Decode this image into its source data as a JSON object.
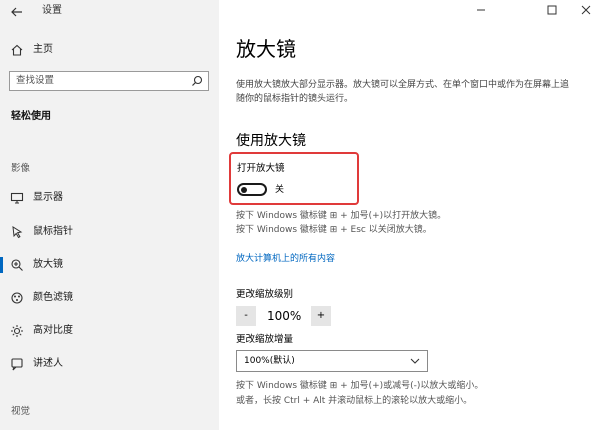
{
  "window": {
    "title": "设置"
  },
  "sidebar": {
    "home_label": "主页",
    "search_placeholder": "查找设置",
    "section_title": "轻松使用",
    "category_vision": "影像",
    "category_hearing": "视觉",
    "items": [
      {
        "label": "显示器",
        "icon": "monitor-icon"
      },
      {
        "label": "鼠标指针",
        "icon": "mouse-pointer-icon"
      },
      {
        "label": "放大镜",
        "icon": "magnifier-icon",
        "active": true
      },
      {
        "label": "颜色滤镜",
        "icon": "color-filter-icon"
      },
      {
        "label": "高对比度",
        "icon": "high-contrast-icon"
      },
      {
        "label": "讲述人",
        "icon": "narrator-icon"
      }
    ]
  },
  "main": {
    "page_title": "放大镜",
    "description": "使用放大镜放大部分显示器。放大镜可以全屏方式、在单个窗口中或作为在屏幕上追随你的鼠标指针的镜头运行。",
    "subheading": "使用放大镜",
    "toggle": {
      "label": "打开放大镜",
      "state_text": "关",
      "on": false
    },
    "hint1": "按下 Windows 徽标键 ⊞ + 加号(+)以打开放大镜。",
    "hint2": "按下 Windows 徽标键 ⊞ + Esc 以关闭放大镜。",
    "link": "放大计算机上的所有内容",
    "zoom": {
      "label": "更改缩放级别",
      "minus": "-",
      "value": "100%",
      "plus": "+"
    },
    "increment": {
      "label": "更改缩放增量",
      "selected": "100%(默认)"
    },
    "hint3": "按下 Windows 徽标键 ⊞ + 加号(+)或减号(-)以放大或缩小。",
    "hint4": "或者，长按 Ctrl + Alt 并滚动鼠标上的滚轮以放大或缩小。"
  },
  "colors": {
    "accent": "#0067c0",
    "highlight_box": "#e03a3a",
    "sidebar_bg": "#f2f2f2"
  }
}
